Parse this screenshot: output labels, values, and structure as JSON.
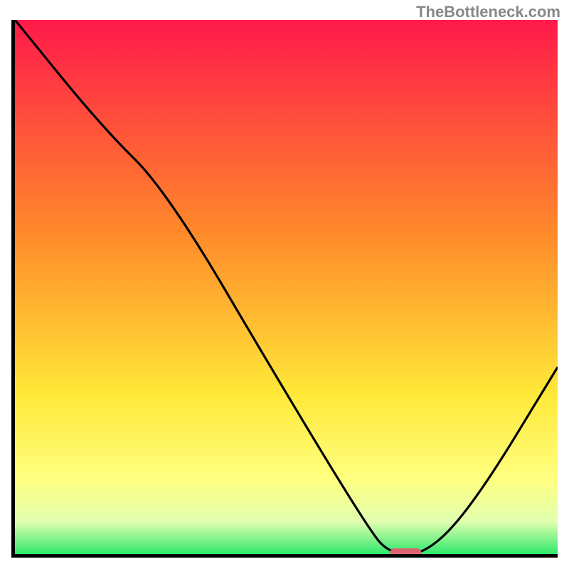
{
  "watermark": "TheBottleneck.com",
  "chart_data": {
    "type": "line",
    "title": "",
    "xlabel": "",
    "ylabel": "",
    "x_range": [
      0,
      100
    ],
    "y_range": [
      0,
      100
    ],
    "gradient_stops": [
      {
        "offset": 0,
        "color": "#ff1a4a"
      },
      {
        "offset": 40,
        "color": "#ff8a2a"
      },
      {
        "offset": 70,
        "color": "#ffe838"
      },
      {
        "offset": 86,
        "color": "#ffff80"
      },
      {
        "offset": 94,
        "color": "#e0ffb0"
      },
      {
        "offset": 100,
        "color": "#2ee86b"
      }
    ],
    "marker": {
      "x": 72,
      "y": 0,
      "color": "#d9646f"
    },
    "series": [
      {
        "name": "curve",
        "points": [
          {
            "x": 0,
            "y": 100
          },
          {
            "x": 16,
            "y": 80
          },
          {
            "x": 28,
            "y": 68
          },
          {
            "x": 50,
            "y": 30
          },
          {
            "x": 65,
            "y": 5
          },
          {
            "x": 69,
            "y": 0
          },
          {
            "x": 76,
            "y": 0
          },
          {
            "x": 85,
            "y": 10
          },
          {
            "x": 100,
            "y": 35
          }
        ]
      }
    ]
  }
}
